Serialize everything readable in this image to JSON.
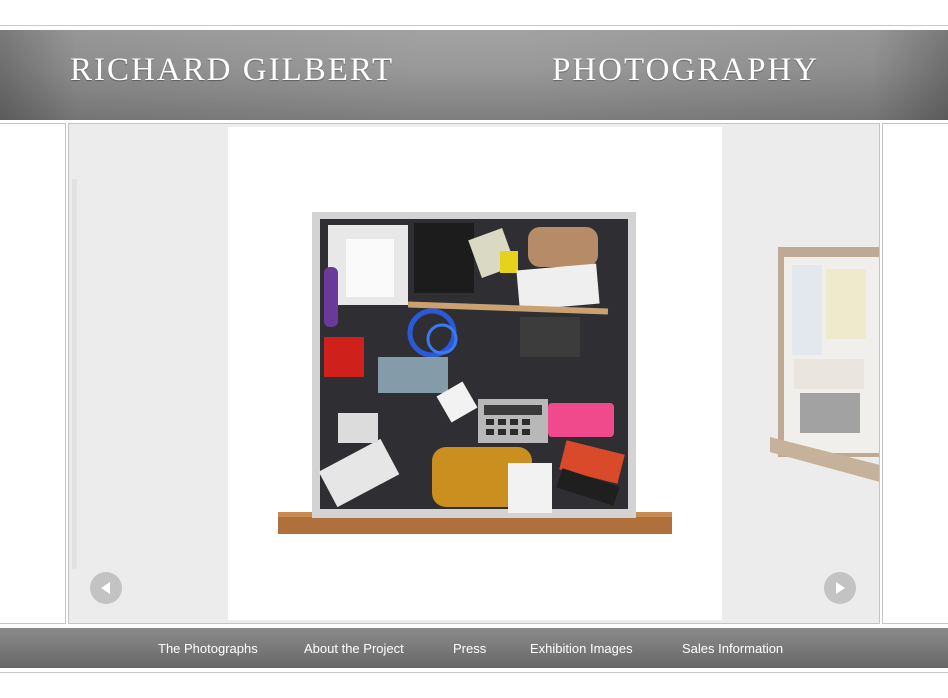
{
  "header": {
    "name": "RICHARD GILBERT",
    "subtitle": "PHOTOGRAPHY"
  },
  "gallery": {
    "current_photo": "drawer-contents-photo",
    "next_preview": "desk-drawer-preview",
    "prev_icon": "chevron-left-icon",
    "next_icon": "chevron-right-icon",
    "arrow_color": "#c3c3c3"
  },
  "nav": {
    "items": [
      {
        "label": "The Photographs"
      },
      {
        "label": "About the Project"
      },
      {
        "label": "Press"
      },
      {
        "label": "Exhibition Images"
      },
      {
        "label": "Sales Information"
      }
    ]
  }
}
